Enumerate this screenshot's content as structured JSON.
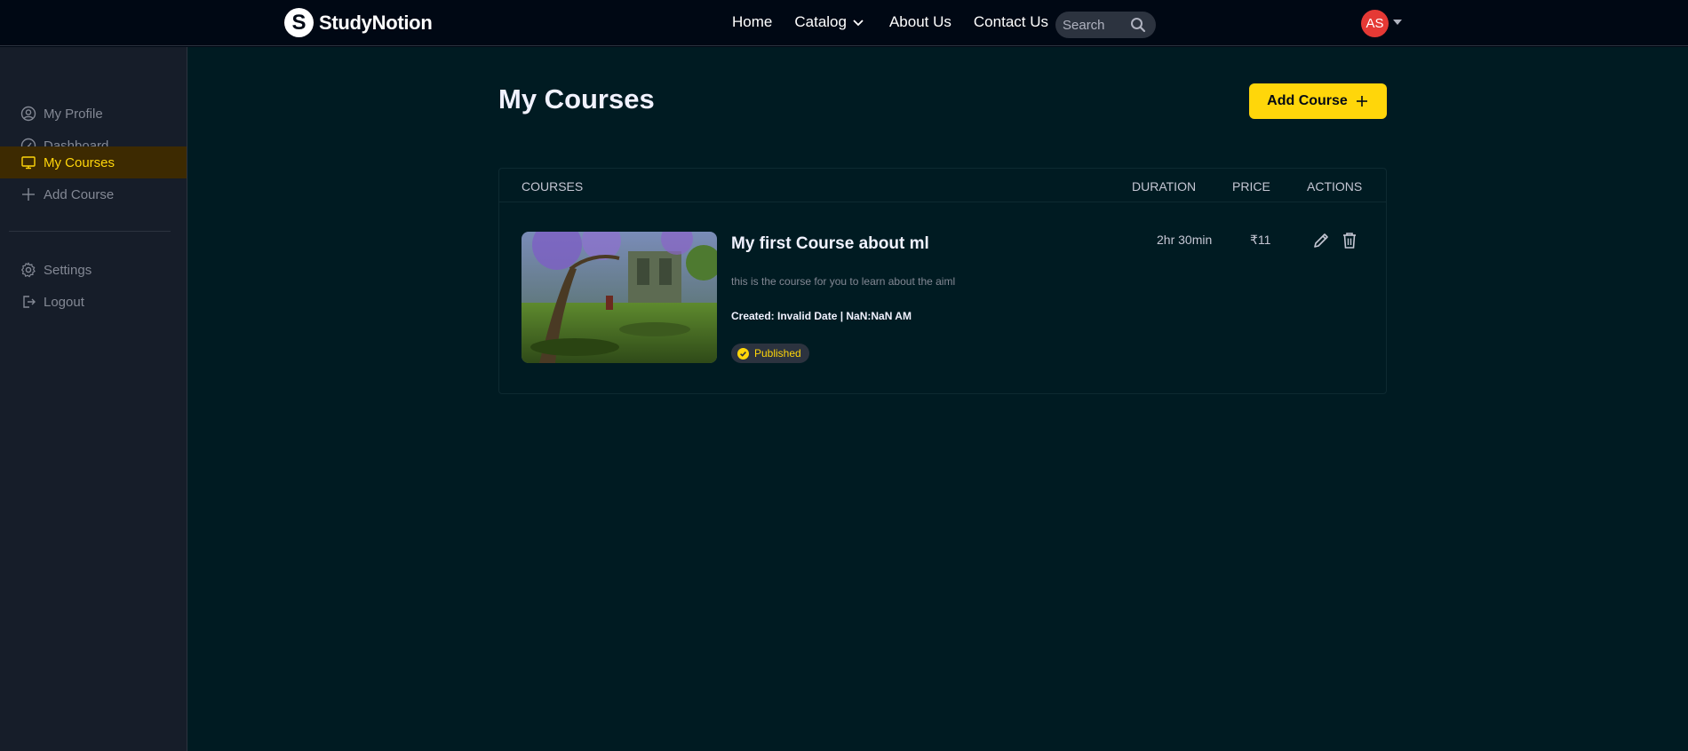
{
  "navbar": {
    "logo_letter": "S",
    "brand": "StudyNotion",
    "links": {
      "home": "Home",
      "catalog": "Catalog",
      "about": "About Us",
      "contact": "Contact Us"
    },
    "search_placeholder": "Search",
    "avatar_initials": "AS"
  },
  "sidebar": {
    "items": [
      {
        "label": "My Profile",
        "icon": "user-circle-icon"
      },
      {
        "label": "Dashboard",
        "icon": "gauge-icon"
      },
      {
        "label": "My Courses",
        "icon": "monitor-icon",
        "active": true
      },
      {
        "label": "Add Course",
        "icon": "plus-icon"
      }
    ],
    "bottom_items": [
      {
        "label": "Settings",
        "icon": "gear-icon"
      },
      {
        "label": "Logout",
        "icon": "logout-icon"
      }
    ]
  },
  "main": {
    "title": "My Courses",
    "add_button": "Add Course",
    "table": {
      "headers": {
        "courses": "COURSES",
        "duration": "DURATION",
        "price": "PRICE",
        "actions": "ACTIONS"
      },
      "rows": [
        {
          "title": "My first Course about ml",
          "description": "this is the course for you to learn about the aiml",
          "created": "Created: Invalid Date | NaN:NaN AM",
          "status": "Published",
          "duration": "2hr 30min",
          "price": "₹11"
        }
      ]
    }
  },
  "colors": {
    "accent": "#FFD60A",
    "background": "#000814",
    "main_background": "#001B22",
    "sidebar_background": "#161D29",
    "active_item_bg": "#3D2A01",
    "avatar": "#E53935"
  }
}
